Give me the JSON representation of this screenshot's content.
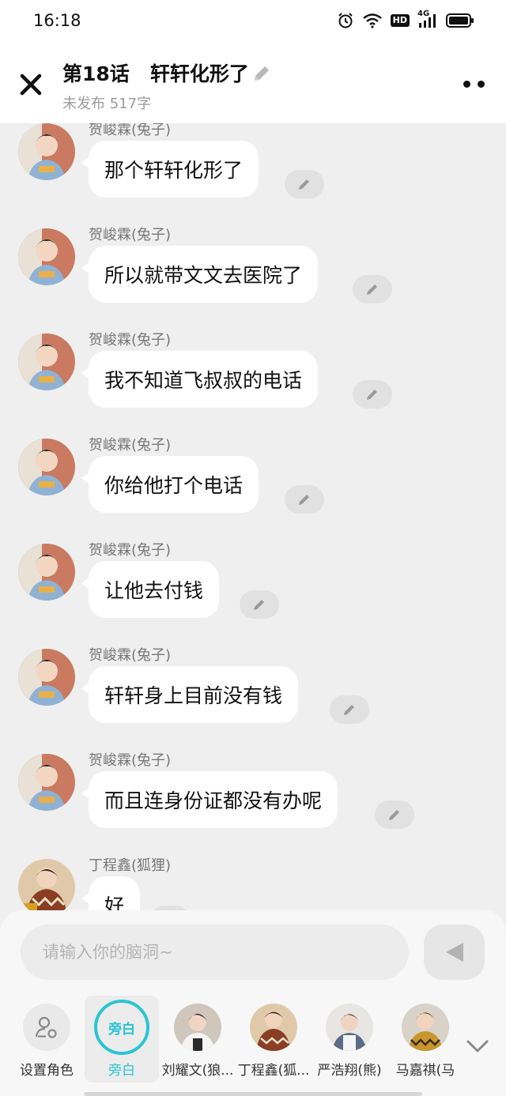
{
  "status_bar": {
    "time": "16:18",
    "hd_label": "HD",
    "network_label": "4G"
  },
  "header": {
    "title": "第18话   轩轩化形了",
    "subtitle": "未发布 517字"
  },
  "messages": [
    {
      "sender": "贺峻霖(兔子)",
      "text": "那个轩轩化形了"
    },
    {
      "sender": "贺峻霖(兔子)",
      "text": "所以就带文文去医院了"
    },
    {
      "sender": "贺峻霖(兔子)",
      "text": "我不知道飞叔叔的电话"
    },
    {
      "sender": "贺峻霖(兔子)",
      "text": "你给他打个电话"
    },
    {
      "sender": "贺峻霖(兔子)",
      "text": "让他去付钱"
    },
    {
      "sender": "贺峻霖(兔子)",
      "text": "轩轩身上目前没有钱"
    },
    {
      "sender": "贺峻霖(兔子)",
      "text": "而且连身份证都没有办呢"
    },
    {
      "sender": "丁程鑫(狐狸)",
      "text": "好"
    }
  ],
  "input": {
    "placeholder": "请输入你的脑洞~"
  },
  "roles": {
    "set_role_label": "设置角色",
    "narrator_label": "旁白",
    "narrator_avatar_text": "旁白",
    "characters": [
      {
        "label": "刘耀文(狼..."
      },
      {
        "label": "丁程鑫(狐..."
      },
      {
        "label": "严浩翔(熊)"
      },
      {
        "label": "马嘉祺(马"
      }
    ]
  },
  "colors": {
    "accent": "#2bc4d3",
    "bubble": "#ffffff",
    "background": "#efefef"
  }
}
